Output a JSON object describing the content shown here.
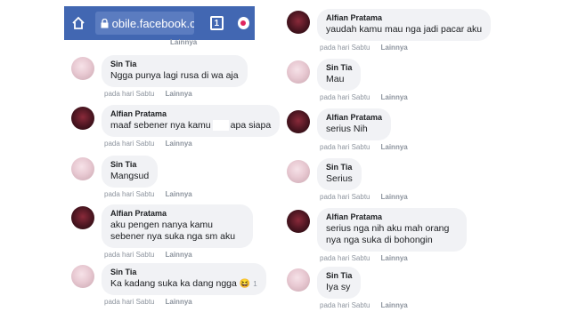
{
  "browser": {
    "url": "obile.facebook.com",
    "tab_count": "1"
  },
  "left": {
    "top_meta_more": "Lainnya",
    "messages": [
      {
        "name": "Sin Tia",
        "text": "Ngga punya lagi rusa di wa aja",
        "time": "pada hari Sabtu",
        "more": "Lainnya"
      },
      {
        "name": "Alfian Pratama",
        "text_a": "maaf sebener nya kamu",
        "text_b": "apa siapa",
        "time": "pada hari Sabtu",
        "more": "Lainnya"
      },
      {
        "name": "Sin Tia",
        "text": "Mangsud",
        "time": "pada hari Sabtu",
        "more": "Lainnya"
      },
      {
        "name": "Alfian Pratama",
        "text": "aku pengen nanya kamu sebener nya suka nga sm aku",
        "time": "pada hari Sabtu",
        "more": "Lainnya"
      },
      {
        "name": "Sin Tia",
        "text": "Ka kadang suka ka dang ngga",
        "emoji": "😆",
        "reaction_count": "1",
        "time": "pada hari Sabtu",
        "more": "Lainnya"
      }
    ]
  },
  "right": {
    "messages": [
      {
        "name": "Alfian Pratama",
        "text": "yaudah kamu mau nga jadi pacar aku",
        "time": "pada hari Sabtu",
        "more": "Lainnya"
      },
      {
        "name": "Sin Tia",
        "text": "Mau",
        "time": "pada hari Sabtu",
        "more": "Lainnya"
      },
      {
        "name": "Alfian Pratama",
        "text": "serius Nih",
        "time": "pada hari Sabtu",
        "more": "Lainnya"
      },
      {
        "name": "Sin Tia",
        "text": "Serius",
        "time": "pada hari Sabtu",
        "more": "Lainnya"
      },
      {
        "name": "Alfian Pratama",
        "text": "serius nga nih aku mah orang nya nga suka di bohongin",
        "time": "pada hari Sabtu",
        "more": "Lainnya"
      },
      {
        "name": "Sin Tia",
        "text": "Iya sy",
        "time": "pada hari Sabtu",
        "more": "Lainnya"
      }
    ]
  },
  "colors": {
    "browser_bar": "#4267b2",
    "bubble": "#f1f2f5",
    "meta_text": "#8d949e"
  }
}
